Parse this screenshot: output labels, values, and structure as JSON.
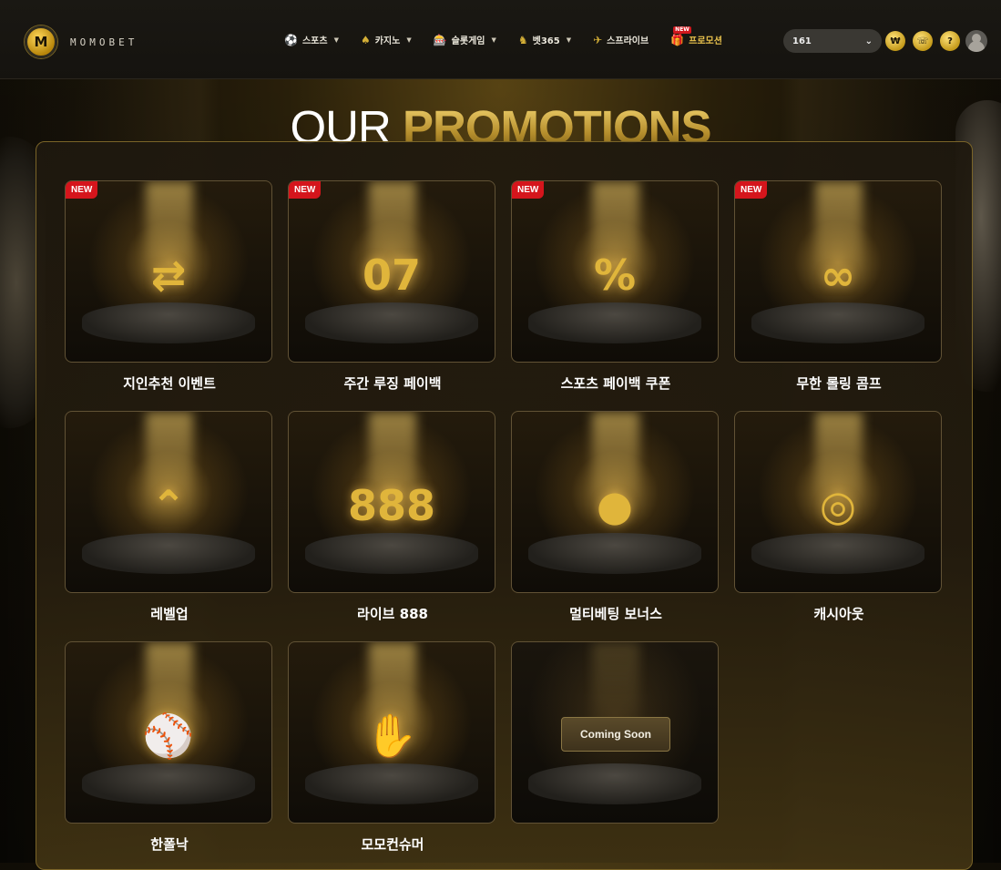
{
  "brand": {
    "name": "MOMOBET",
    "logo_letter": "M"
  },
  "nav": [
    {
      "label": "스포츠",
      "icon": "soccer-ball-icon",
      "glyph": "⚽",
      "dropdown": true
    },
    {
      "label": "카지노",
      "icon": "spade-icon",
      "glyph": "♠",
      "dropdown": true
    },
    {
      "label": "슬롯게임",
      "icon": "slot-machine-icon",
      "glyph": "🎰",
      "dropdown": true
    },
    {
      "label": "벳365",
      "icon": "chess-knight-icon",
      "glyph": "♞",
      "dropdown": true
    },
    {
      "label": "스프라이브",
      "icon": "plane-icon",
      "glyph": "✈",
      "dropdown": false
    },
    {
      "label": "프로모션",
      "icon": "gift-icon",
      "glyph": "🎁",
      "dropdown": false,
      "badge": "NEW"
    }
  ],
  "account": {
    "balance": "161",
    "buttons": [
      {
        "icon": "wallet-icon",
        "glyph": "₩"
      },
      {
        "icon": "headset-icon",
        "glyph": "☏"
      },
      {
        "icon": "help-icon",
        "glyph": "?"
      }
    ]
  },
  "title": {
    "part1": "OUR ",
    "part2": "PROMOTIONS"
  },
  "promotions": [
    {
      "label": "지인추천 이벤트",
      "badge": "NEW",
      "art": "⇄"
    },
    {
      "label": "주간 루징 페이백",
      "badge": "NEW",
      "art": "07"
    },
    {
      "label": "스포츠 페이백 쿠폰",
      "badge": "NEW",
      "art": "%"
    },
    {
      "label": "무한 롤링 콤프",
      "badge": "NEW",
      "art": "∞"
    },
    {
      "label": "레벨업",
      "badge": "",
      "art": "⌃"
    },
    {
      "label": "라이브 888",
      "badge": "",
      "art": "888"
    },
    {
      "label": "멀티베팅 보너스",
      "badge": "",
      "art": "●"
    },
    {
      "label": "캐시아웃",
      "badge": "",
      "art": "◎"
    },
    {
      "label": "한폴낙",
      "badge": "",
      "art": "⚾"
    },
    {
      "label": "모모컨슈머",
      "badge": "",
      "art": "✋"
    }
  ],
  "coming_soon": {
    "label": "Coming Soon"
  },
  "colors": {
    "accent": "#d4af37",
    "new_badge": "#d5151c",
    "panel_border": "#7a6428"
  }
}
